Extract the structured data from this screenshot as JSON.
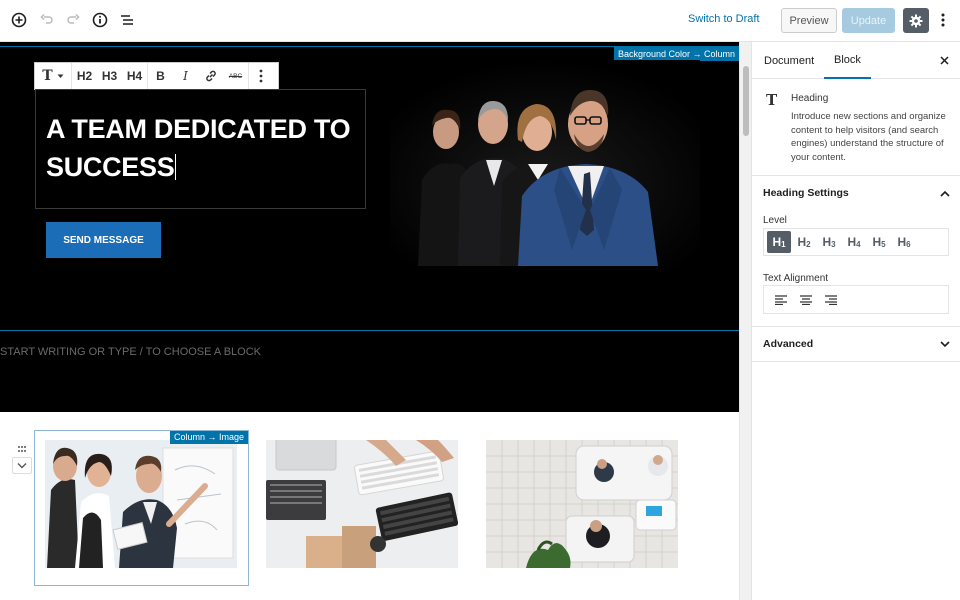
{
  "topbar": {
    "add_icon": "plus-circle-icon",
    "undo_icon": "undo-icon",
    "redo_icon": "redo-icon",
    "info_icon": "info-icon",
    "outline_icon": "list-icon",
    "switch_draft_label": "Switch to Draft",
    "preview_label": "Preview",
    "update_label": "Update",
    "settings_icon": "gear-icon",
    "more_icon": "vertical-ellipsis-icon"
  },
  "hero": {
    "background_label": "Background Color → Column",
    "toolbar": {
      "paragraph_icon": "T",
      "h2": "H2",
      "h3": "H3",
      "h4": "H4",
      "bold": "B",
      "italic": "I",
      "link_icon": "link-icon",
      "strike": "ABC",
      "more_icon": "vertical-ellipsis-icon"
    },
    "heading": "A TEAM DEDICATED TO SUCCESS",
    "button_label": "SEND MESSAGE",
    "placeholder": "START WRITING OR TYPE / TO CHOOSE A BLOCK"
  },
  "columns": {
    "selected_label": "Column → Image"
  },
  "sidebar": {
    "tabs": [
      "Document",
      "Block"
    ],
    "active_tab": "Block",
    "close_icon": "close-icon",
    "block_card": {
      "icon": "T",
      "title": "Heading",
      "description": "Introduce new sections and organize content to help visitors (and search engines) understand the structure of your content."
    },
    "heading_settings": {
      "title": "Heading Settings",
      "level_label": "Level",
      "levels": [
        "H1",
        "H2",
        "H3",
        "H4",
        "H5",
        "H6"
      ],
      "active_level": "H1",
      "alignment_label": "Text Alignment"
    },
    "advanced": {
      "title": "Advanced"
    }
  },
  "colors": {
    "accent": "#0073aa",
    "button": "#1b6db8",
    "hero_bg": "#000000"
  }
}
